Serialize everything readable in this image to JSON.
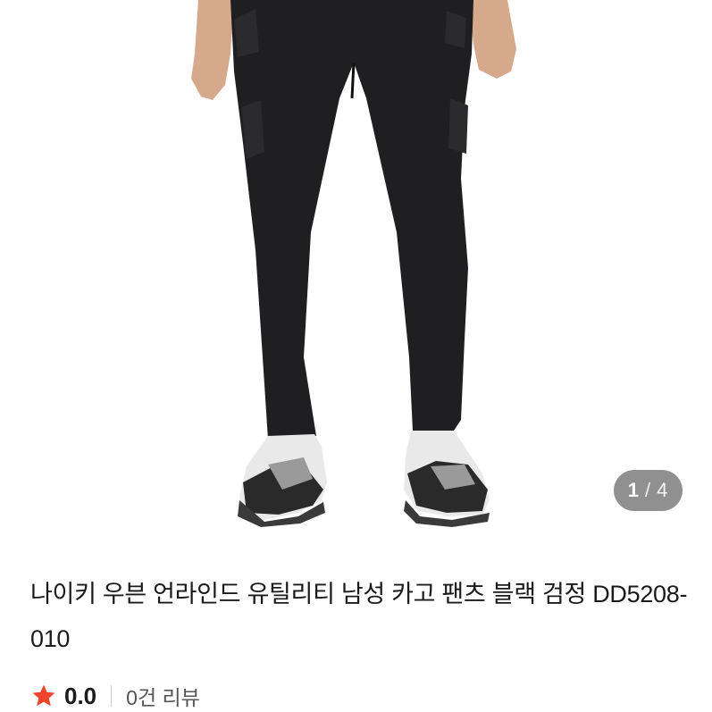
{
  "gallery": {
    "current": "1",
    "separator": "/",
    "total": "4",
    "image_alt": "black cargo pants"
  },
  "product": {
    "title": "나이키 우븐 언라인드 유틸리티 남성 카고 팬츠 블랙 검정 DD5208-010"
  },
  "rating": {
    "score": "0.0",
    "review_count": "0건 리뷰",
    "star_color": "#f0452b",
    "icon": "star-icon"
  }
}
